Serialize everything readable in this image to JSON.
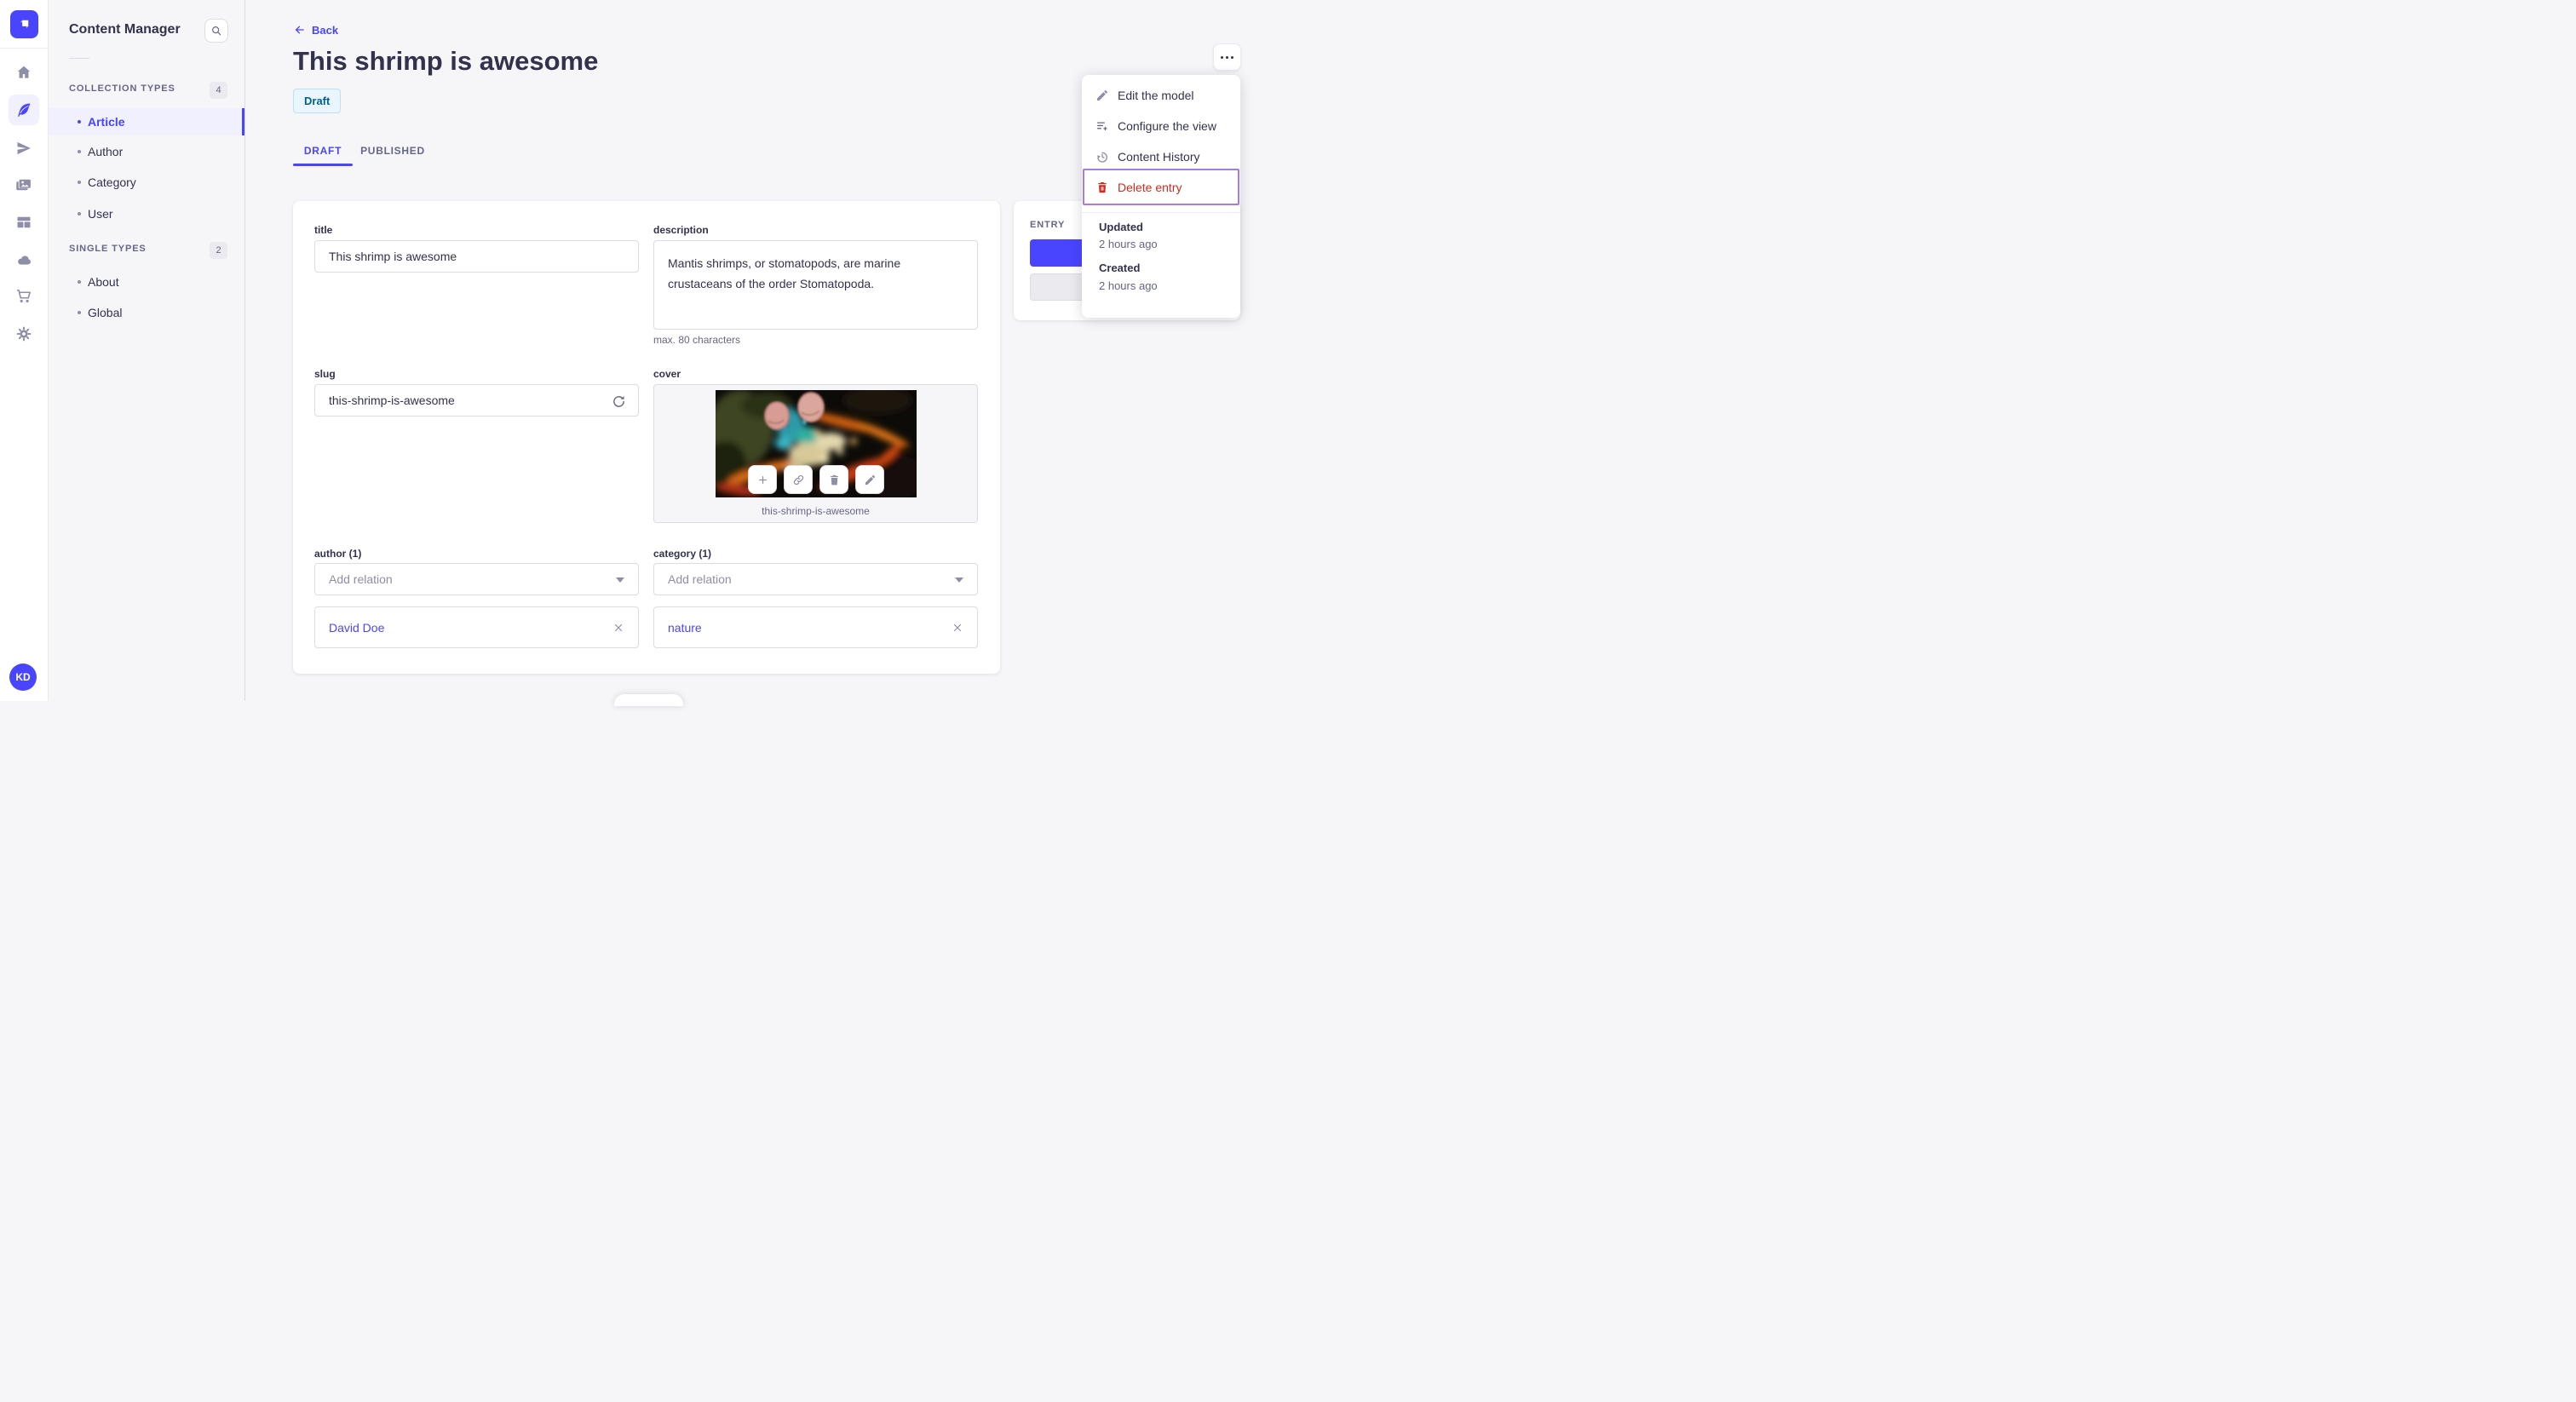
{
  "nav_rail": {
    "items": [
      {
        "icon": "home-icon",
        "active": false
      },
      {
        "icon": "content-manager-icon",
        "active": true
      },
      {
        "icon": "release-icon",
        "active": false
      },
      {
        "icon": "media-library-icon",
        "active": false
      },
      {
        "icon": "layout-icon",
        "active": false
      },
      {
        "icon": "cloud-icon",
        "active": false
      },
      {
        "icon": "marketplace-icon",
        "active": false
      },
      {
        "icon": "settings-icon",
        "active": false
      }
    ],
    "avatar_initials": "KD"
  },
  "sidebar": {
    "title": "Content Manager",
    "sections": [
      {
        "label": "COLLECTION TYPES",
        "count": "4",
        "items": [
          {
            "label": "Article",
            "active": true
          },
          {
            "label": "Author",
            "active": false
          },
          {
            "label": "Category",
            "active": false
          },
          {
            "label": "User",
            "active": false
          }
        ]
      },
      {
        "label": "SINGLE TYPES",
        "count": "2",
        "items": [
          {
            "label": "About",
            "active": false
          },
          {
            "label": "Global",
            "active": false
          }
        ]
      }
    ]
  },
  "header": {
    "back_label": "Back",
    "title": "This shrimp is awesome",
    "status": "Draft",
    "tabs": [
      {
        "label": "DRAFT",
        "active": true
      },
      {
        "label": "PUBLISHED",
        "active": false
      }
    ]
  },
  "context_menu": {
    "items": [
      {
        "label": "Edit the model",
        "icon": "pencil-icon",
        "danger": false
      },
      {
        "label": "Configure the view",
        "icon": "configure-list-icon",
        "danger": false
      },
      {
        "label": "Content History",
        "icon": "history-icon",
        "danger": false
      },
      {
        "label": "Delete entry",
        "icon": "trash-icon",
        "danger": true,
        "focused": true
      }
    ],
    "meta": [
      {
        "label": "Updated",
        "value": "2 hours ago"
      },
      {
        "label": "Created",
        "value": "2 hours ago"
      }
    ]
  },
  "entry_panel": {
    "label": "ENTRY"
  },
  "form": {
    "title": {
      "label": "title",
      "value": "This shrimp is awesome"
    },
    "description": {
      "label": "description",
      "value": "Mantis shrimps, or stomatopods, are marine crustaceans of the order Stomatopoda.",
      "helper": "max. 80 characters"
    },
    "slug": {
      "label": "slug",
      "value": "this-shrimp-is-awesome"
    },
    "cover": {
      "label": "cover",
      "caption": "this-shrimp-is-awesome"
    },
    "author": {
      "label": "author (1)",
      "placeholder": "Add relation",
      "relations": [
        {
          "name": "David Doe"
        }
      ]
    },
    "category": {
      "label": "category (1)",
      "placeholder": "Add relation",
      "relations": [
        {
          "name": "nature"
        }
      ]
    }
  },
  "colors": {
    "primary": "#4945FF",
    "primary_light_bg": "#F0F0FF",
    "danger": "#D02B20",
    "draft_bg": "#EAF5FF",
    "draft_border": "#B8E1FF",
    "draft_text": "#006096",
    "focus_ring": "#A878F0",
    "page_bg": "#F6F6F9"
  }
}
